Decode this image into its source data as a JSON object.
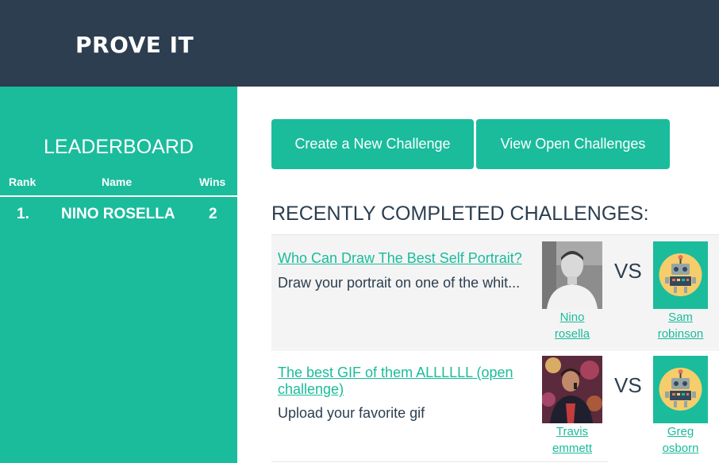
{
  "header": {
    "brand": "PROVE IT"
  },
  "sidebar": {
    "title": "LEADERBOARD",
    "columns": {
      "rank": "Rank",
      "name": "Name",
      "wins": "Wins"
    },
    "rows": [
      {
        "rank": "1.",
        "name": "NINO ROSELLA",
        "wins": "2"
      }
    ]
  },
  "actions": {
    "create_label": "Create a New Challenge",
    "view_label": "View Open Challenges"
  },
  "main": {
    "section_title": "RECENTLY COMPLETED CHALLENGES:",
    "vs_label": "VS",
    "challenges": [
      {
        "title": "Who Can Draw The Best Self Portrait?",
        "description": "Draw your portrait on one of the whit...",
        "player1": {
          "name_line1": "Nino",
          "name_line2": "rosella",
          "avatar": "photo-man-icon"
        },
        "player2": {
          "name_line1": "Sam",
          "name_line2": "robinson",
          "avatar": "robot-icon"
        }
      },
      {
        "title": "The best GIF of them ALLLLLL (open challenge)",
        "description": "Upload your favorite gif",
        "player1": {
          "name_line1": "Travis",
          "name_line2": "emmett",
          "avatar": "photo-singer-icon"
        },
        "player2": {
          "name_line1": "Greg",
          "name_line2": "osborn",
          "avatar": "robot-icon"
        }
      }
    ]
  },
  "colors": {
    "header": "#2c3e50",
    "accent": "#1abc9c",
    "text": "#2c3e50",
    "card_bg": "#f4f4f4"
  }
}
